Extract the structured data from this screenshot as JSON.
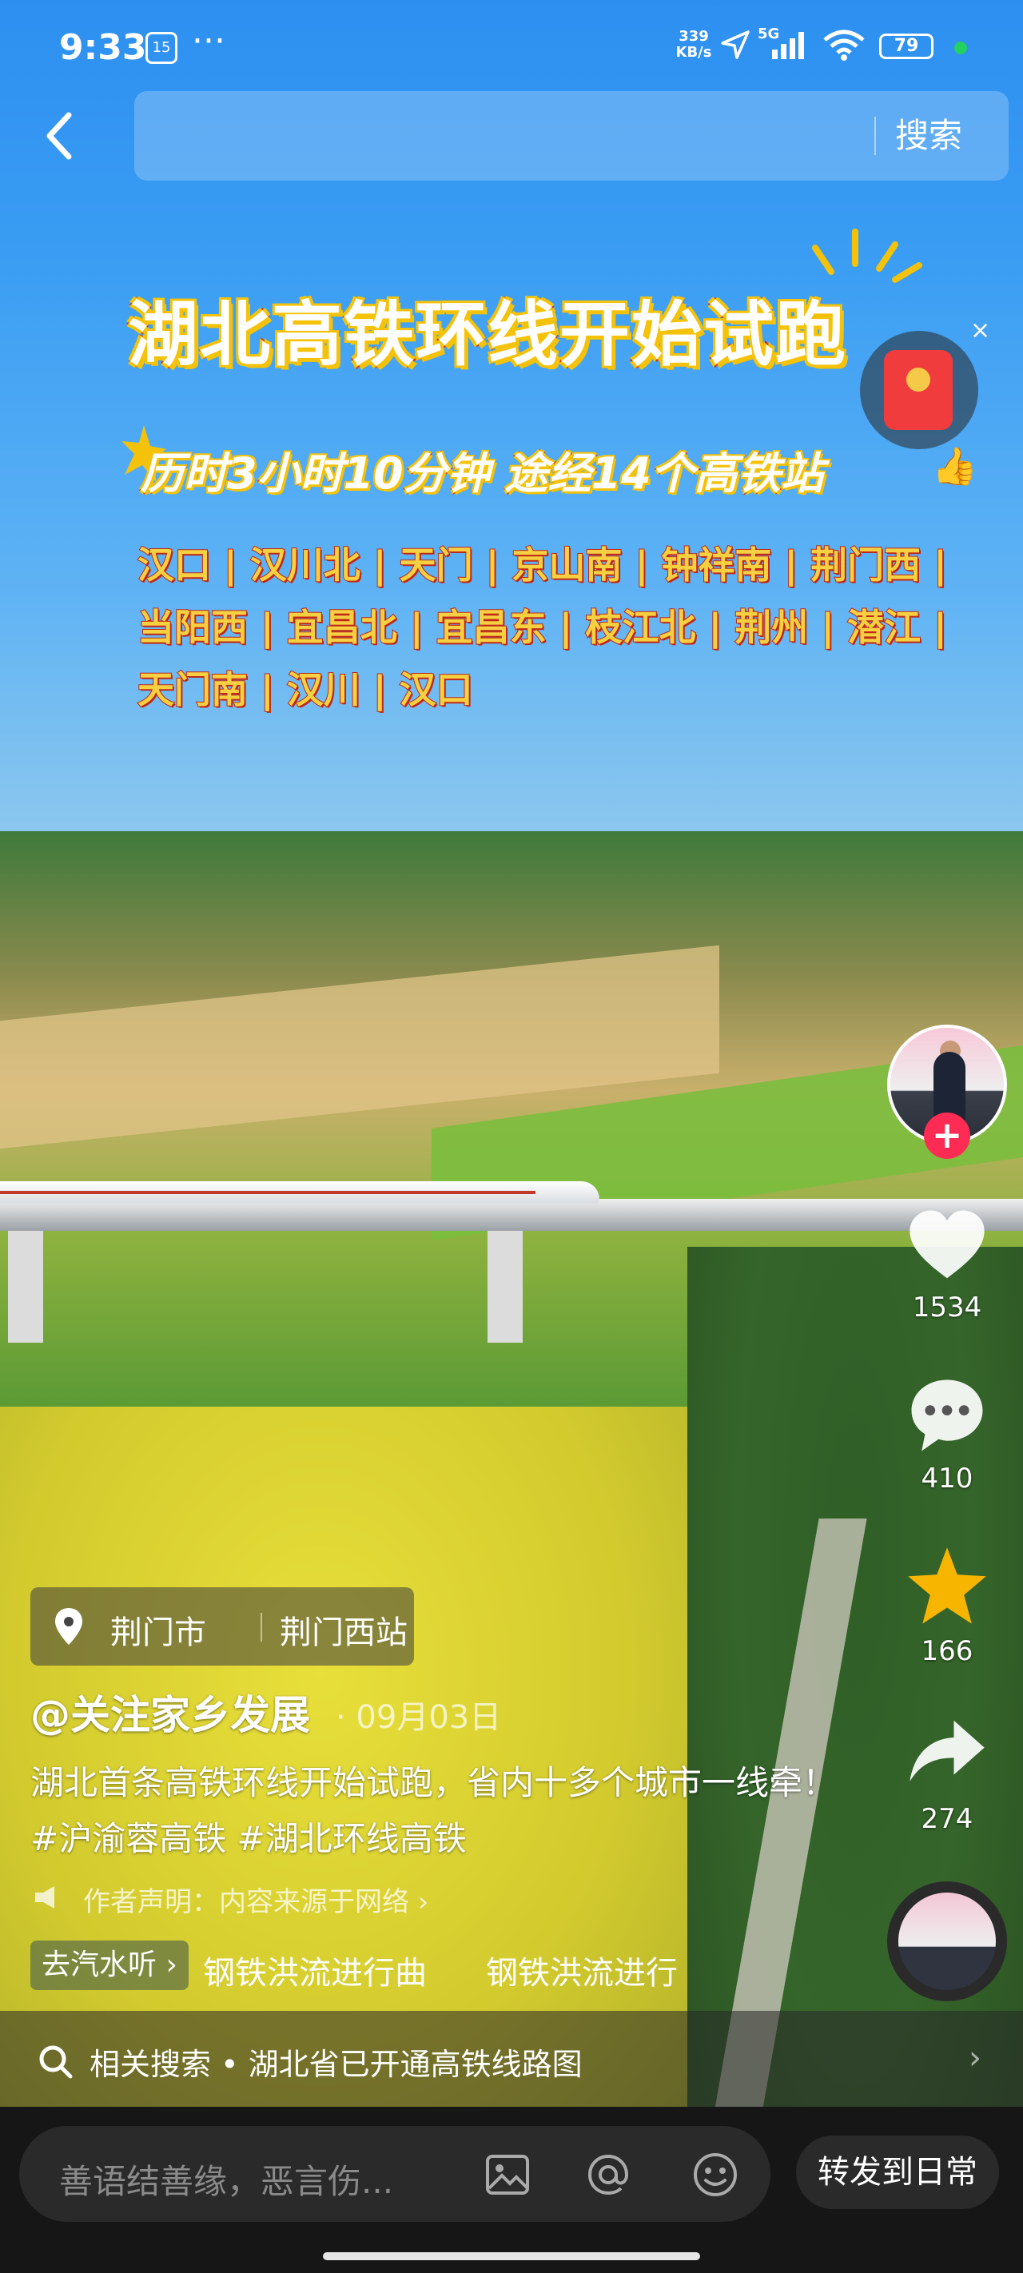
{
  "status_bar": {
    "time": "9:33",
    "date_badge": "15",
    "more": "···",
    "net_speed_top": "339",
    "net_speed_bottom": "KB/s",
    "signal": "5G",
    "battery": "79"
  },
  "header": {
    "search_button": "搜索"
  },
  "video_overlay": {
    "title": "湖北高铁环线开始试跑",
    "subtitle": "历时3小时10分钟 途经14个高铁站",
    "stations": "汉口 | 汉川北 | 天门 | 京山南 | 钟祥南 | 荆门西 | 当阳西 | 宜昌北 | 宜昌东 | 枝江北 | 荆州 | 潜江 | 天门南 | 汉川 | 汉口"
  },
  "actions": {
    "likes": "1534",
    "comments": "410",
    "favorites": "166",
    "shares": "274",
    "follow": "+"
  },
  "post": {
    "location_city": "荆门市",
    "location_station": "荆门西站",
    "author": "@关注家乡发展",
    "date": "· 09月03日",
    "description": "湖北首条高铁环线开始试跑，省内十多个城市一线牵！#沪渝蓉高铁 #湖北环线高铁",
    "disclaimer": "作者声明：内容来源于网络 ›",
    "music_tag": "去汽水听 ›",
    "music_title": "钢铁洪流进行曲",
    "music_title_scroll": "钢铁洪流进行"
  },
  "related_search": {
    "text": "相关搜索 • 湖北省已开通高铁线路图",
    "arrow": "›"
  },
  "bottom": {
    "comment_placeholder": "善语结善缘，恶言伤...",
    "share_daily": "转发到日常"
  },
  "colors": {
    "accent_red": "#fe2c55",
    "title_stroke": "#d72d1e",
    "title_glow": "#f5c20a",
    "favorite_star": "#f7b500"
  }
}
